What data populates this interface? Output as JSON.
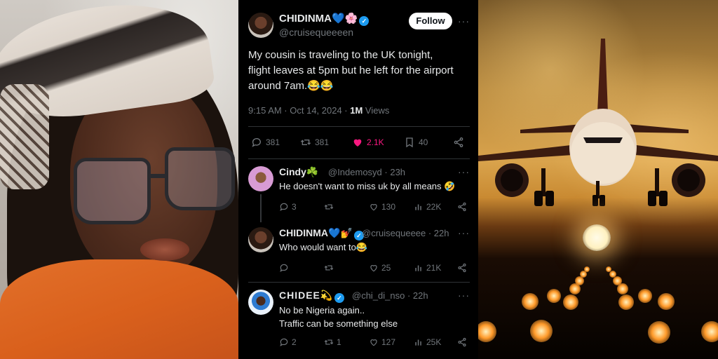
{
  "main_tweet": {
    "display_name": "CHIDINMA",
    "handle": "@cruisequeeeen",
    "follow_label": "Follow",
    "more_label": "···",
    "text": "My cousin is traveling to the UK tonight,\nflight leaves at 5pm but he left for the airport\naround 7am.😂😂",
    "time": "9:15 AM · Oct 14, 2024 · ",
    "views_count": "1M",
    "views_label": " Views",
    "stats": {
      "replies": "381",
      "reposts": "381",
      "likes": "2.1K",
      "bookmarks": "40"
    }
  },
  "replies": [
    {
      "display_name": "Cindy☘️",
      "handle_time": "@Indemosyd · 23h",
      "text": "He doesn't want to miss uk by all means 🤣",
      "replies": "3",
      "reposts": "",
      "likes": "130",
      "views": "22K"
    },
    {
      "display_name": "CHIDINMA",
      "handle_time": "@cruisequeeee · 22h",
      "text": "Who would want to😂",
      "replies": "",
      "reposts": "",
      "likes": "25",
      "views": "21K"
    },
    {
      "display_name": "CHIDEE",
      "handle_time": "@chi_di_nso · 22h",
      "text": "No be Nigeria again..\nTraffic can be something else",
      "replies": "2",
      "reposts": "1",
      "likes": "127",
      "views": "25K"
    }
  ],
  "colors": {
    "accent_blue": "#1d9bf0",
    "like_pink": "#f91880",
    "muted_text": "#71767b",
    "primary_text": "#e7e9ea",
    "background": "#000000"
  }
}
